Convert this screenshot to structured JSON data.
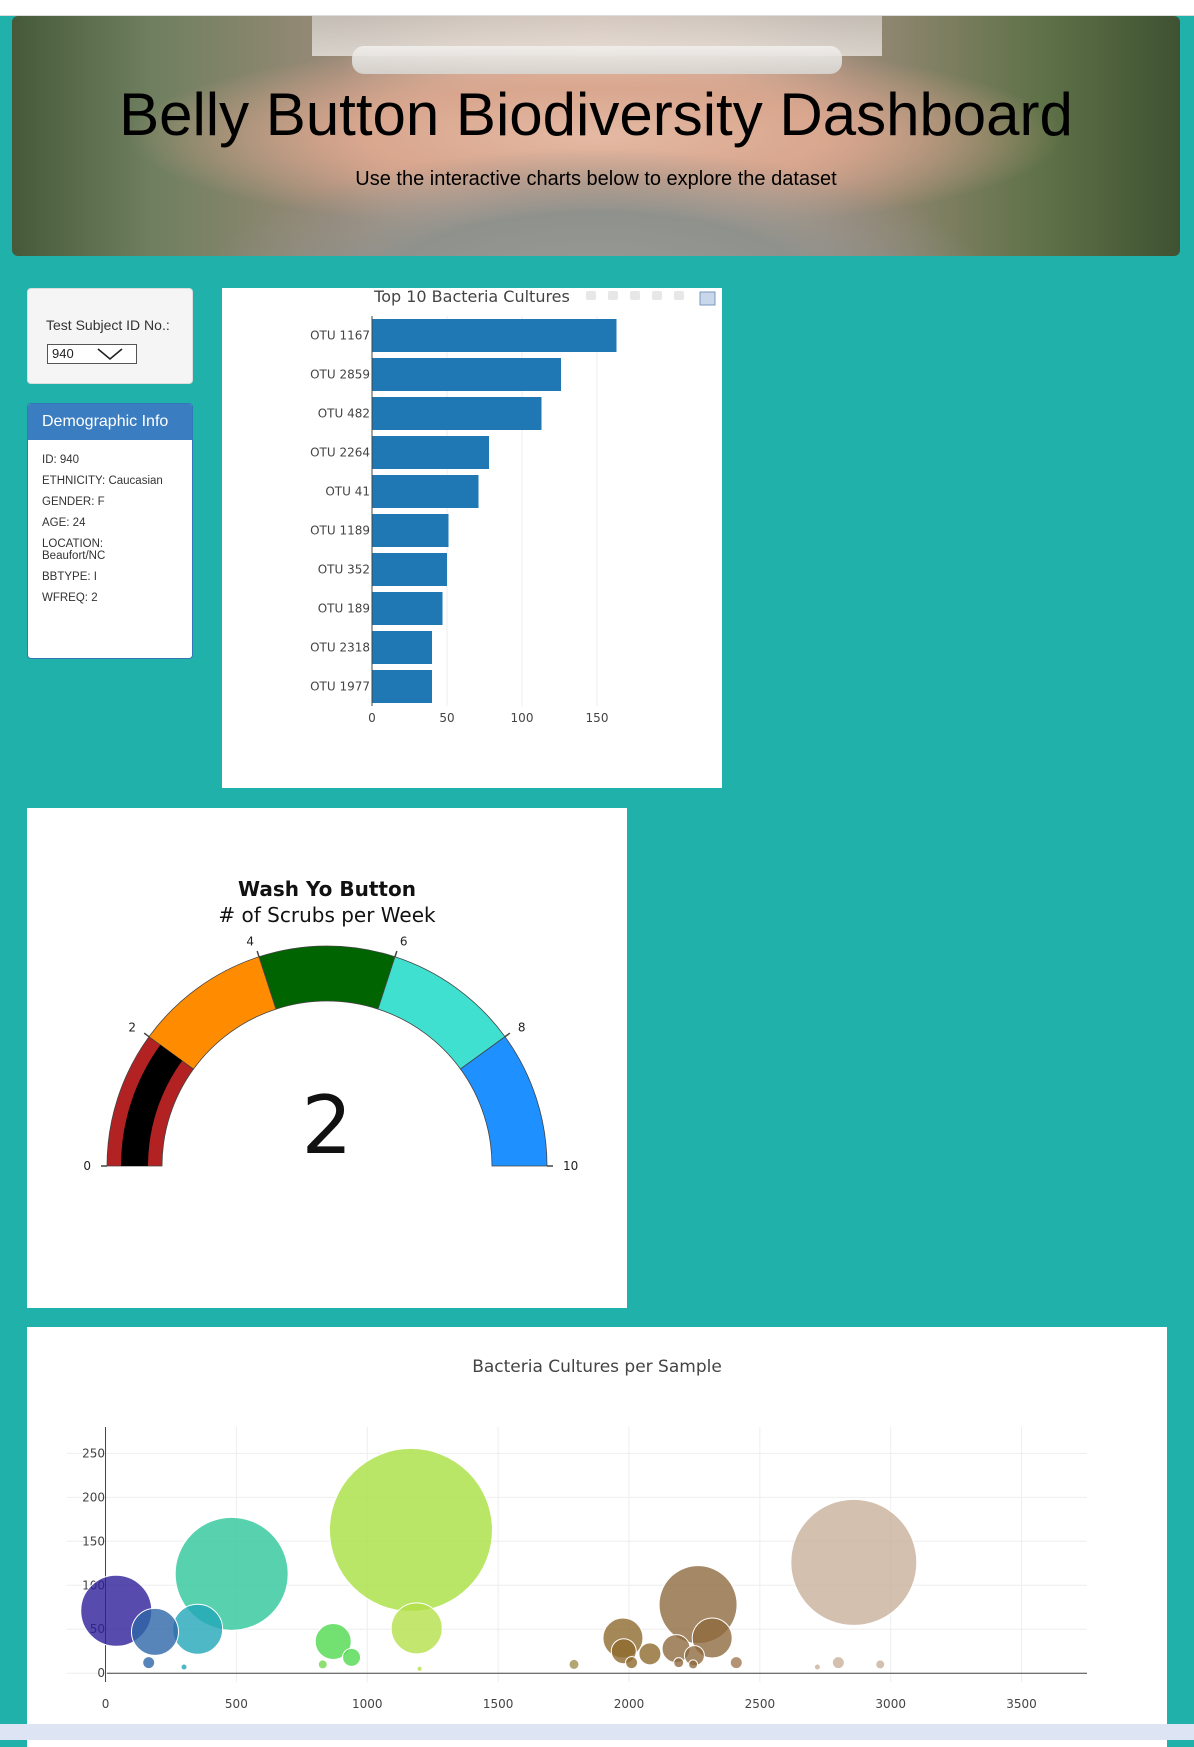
{
  "header": {
    "title": "Belly Button Biodiversity Dashboard",
    "subtitle": "Use the interactive charts below to explore the dataset"
  },
  "selector": {
    "label": "Test Subject ID No.:",
    "value": "940"
  },
  "demographics": {
    "heading": "Demographic Info",
    "lines": [
      "ID: 940",
      "ETHNICITY: Caucasian",
      "GENDER: F",
      "AGE: 24",
      "LOCATION: Beaufort/NC",
      "BBTYPE: I",
      "WFREQ: 2"
    ]
  },
  "colors": {
    "bar": "#1f77b4",
    "background": "#20b2aa"
  },
  "chart_data": [
    {
      "type": "bar",
      "orientation": "horizontal",
      "title": "Top 10 Bacteria Cultures",
      "categories": [
        "OTU 1167",
        "OTU 2859",
        "OTU 482",
        "OTU 2264",
        "OTU 41",
        "OTU 1189",
        "OTU 352",
        "OTU 189",
        "OTU 2318",
        "OTU 1977"
      ],
      "values": [
        163,
        126,
        113,
        78,
        71,
        51,
        50,
        47,
        40,
        40
      ],
      "xlim": [
        0,
        200
      ],
      "xticks": [
        0,
        50,
        100,
        150
      ]
    },
    {
      "type": "gauge",
      "title": "Wash Yo Button",
      "subtitle": "# of Scrubs per Week",
      "value": 2,
      "range": [
        0,
        10
      ],
      "ticks": [
        0,
        2,
        4,
        6,
        8,
        10
      ],
      "steps": [
        {
          "range": [
            0,
            2
          ],
          "color": "#b22222"
        },
        {
          "range": [
            2,
            4
          ],
          "color": "#ff8c00"
        },
        {
          "range": [
            4,
            6
          ],
          "color": "#006400"
        },
        {
          "range": [
            6,
            8
          ],
          "color": "#40e0d0"
        },
        {
          "range": [
            8,
            10
          ],
          "color": "#1e90ff"
        }
      ],
      "bar_color": "#000000"
    },
    {
      "type": "scatter",
      "title": "Bacteria Cultures per Sample",
      "xlim": [
        -300,
        3750
      ],
      "ylim": [
        -10,
        280
      ],
      "xticks": [
        0,
        500,
        1000,
        1500,
        2000,
        2500,
        3000,
        3500
      ],
      "yticks": [
        0,
        50,
        100,
        150,
        200,
        250
      ],
      "points": [
        {
          "x": 41,
          "y": 71,
          "s": 71,
          "color": "#2d1e99"
        },
        {
          "x": 189,
          "y": 47,
          "s": 47,
          "color": "#2e66a8"
        },
        {
          "x": 352,
          "y": 50,
          "s": 50,
          "color": "#22a6b8"
        },
        {
          "x": 482,
          "y": 113,
          "s": 113,
          "color": "#2ec79a"
        },
        {
          "x": 165,
          "y": 12,
          "s": 12,
          "color": "#2e66a8"
        },
        {
          "x": 300,
          "y": 7,
          "s": 6,
          "color": "#22a6b8"
        },
        {
          "x": 870,
          "y": 36,
          "s": 36,
          "color": "#4fd94f"
        },
        {
          "x": 940,
          "y": 18,
          "s": 18,
          "color": "#4fd94f"
        },
        {
          "x": 830,
          "y": 10,
          "s": 9,
          "color": "#72d84f"
        },
        {
          "x": 1167,
          "y": 163,
          "s": 163,
          "color": "#a8e040"
        },
        {
          "x": 1189,
          "y": 51,
          "s": 51,
          "color": "#b4e04a"
        },
        {
          "x": 1200,
          "y": 5,
          "s": 5,
          "color": "#b4e04a"
        },
        {
          "x": 1790,
          "y": 10,
          "s": 10,
          "color": "#a09050"
        },
        {
          "x": 1977,
          "y": 40,
          "s": 40,
          "color": "#8e6a2e"
        },
        {
          "x": 1980,
          "y": 25,
          "s": 25,
          "color": "#8e6a2e"
        },
        {
          "x": 2080,
          "y": 22,
          "s": 22,
          "color": "#8e6a2e"
        },
        {
          "x": 2010,
          "y": 12,
          "s": 12,
          "color": "#8e6a2e"
        },
        {
          "x": 2264,
          "y": 78,
          "s": 78,
          "color": "#8e6a3e"
        },
        {
          "x": 2318,
          "y": 40,
          "s": 40,
          "color": "#8e6a3e"
        },
        {
          "x": 2180,
          "y": 28,
          "s": 28,
          "color": "#8e6a3e"
        },
        {
          "x": 2250,
          "y": 20,
          "s": 20,
          "color": "#8e6a3e"
        },
        {
          "x": 2190,
          "y": 12,
          "s": 10,
          "color": "#8e6a3e"
        },
        {
          "x": 2245,
          "y": 10,
          "s": 9,
          "color": "#8e6a3e"
        },
        {
          "x": 2410,
          "y": 12,
          "s": 12,
          "color": "#a07850"
        },
        {
          "x": 2859,
          "y": 126,
          "s": 126,
          "color": "#c8b09a"
        },
        {
          "x": 2800,
          "y": 12,
          "s": 12,
          "color": "#c8b09a"
        },
        {
          "x": 2960,
          "y": 10,
          "s": 9,
          "color": "#c8b09a"
        },
        {
          "x": 2720,
          "y": 7,
          "s": 6,
          "color": "#c8b09a"
        }
      ]
    }
  ]
}
